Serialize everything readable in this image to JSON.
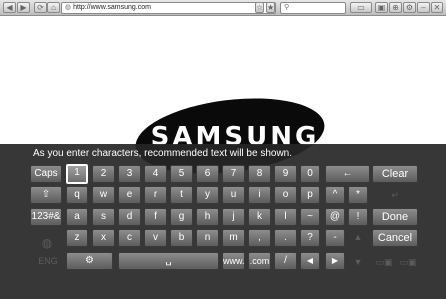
{
  "browser": {
    "url": "http://www.samsung.com",
    "page_logo": "SAMSUNG"
  },
  "keyboard": {
    "hint": "As you enter characters, recommended text will be shown.",
    "keys": {
      "caps": "Caps",
      "n1": "1",
      "n2": "2",
      "n3": "3",
      "n4": "4",
      "n5": "5",
      "n6": "6",
      "n7": "7",
      "n8": "8",
      "n9": "9",
      "n0": "0",
      "backspace": "←",
      "clear": "Clear",
      "shift": "⇧",
      "q": "q",
      "w": "w",
      "e": "e",
      "r": "r",
      "t": "t",
      "y": "y",
      "u": "u",
      "i": "i",
      "o": "o",
      "p": "p",
      "caret": "^",
      "star": "*",
      "symbols": "123#&",
      "a": "a",
      "s": "s",
      "d": "d",
      "f": "f",
      "g": "g",
      "h": "h",
      "j": "j",
      "k": "k",
      "l": "l",
      "tilde": "~",
      "at": "@",
      "excl": "!",
      "done": "Done",
      "z": "z",
      "x": "x",
      "c": "c",
      "v": "v",
      "b": "b",
      "n": "n",
      "m": "m",
      "comma": ",",
      "period": ".",
      "question": "?",
      "dash": "-",
      "cancel": "Cancel",
      "settings": "⚙",
      "space": "␣",
      "www": "www.",
      "com": ".com",
      "slash": "/",
      "left": "◀",
      "right": "▶",
      "language": "ENG"
    }
  }
}
